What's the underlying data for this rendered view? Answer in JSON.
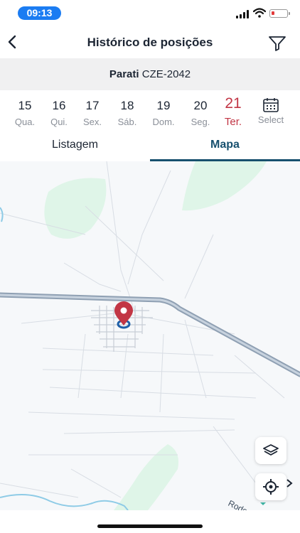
{
  "status_bar": {
    "time": "09:13"
  },
  "header": {
    "title": "Histórico de posições"
  },
  "vehicle": {
    "name": "Parati",
    "plate": "CZE-2042"
  },
  "dates": [
    {
      "day": "15",
      "weekday": "Qua.",
      "active": false
    },
    {
      "day": "16",
      "weekday": "Qui.",
      "active": false
    },
    {
      "day": "17",
      "weekday": "Sex.",
      "active": false
    },
    {
      "day": "18",
      "weekday": "Sáb.",
      "active": false
    },
    {
      "day": "19",
      "weekday": "Dom.",
      "active": false
    },
    {
      "day": "20",
      "weekday": "Seg.",
      "active": false
    },
    {
      "day": "21",
      "weekday": "Ter.",
      "active": true
    }
  ],
  "select_label": "Select",
  "tabs": [
    {
      "label": "Listagem",
      "active": false
    },
    {
      "label": "Mapa",
      "active": true
    }
  ],
  "map": {
    "road_label": "Rodovia Comand"
  },
  "colors": {
    "accent": "#17506e",
    "active_date": "#c23645",
    "marker": "#c23645",
    "time_pill": "#1b7cf2",
    "park": "#dff5e8"
  }
}
